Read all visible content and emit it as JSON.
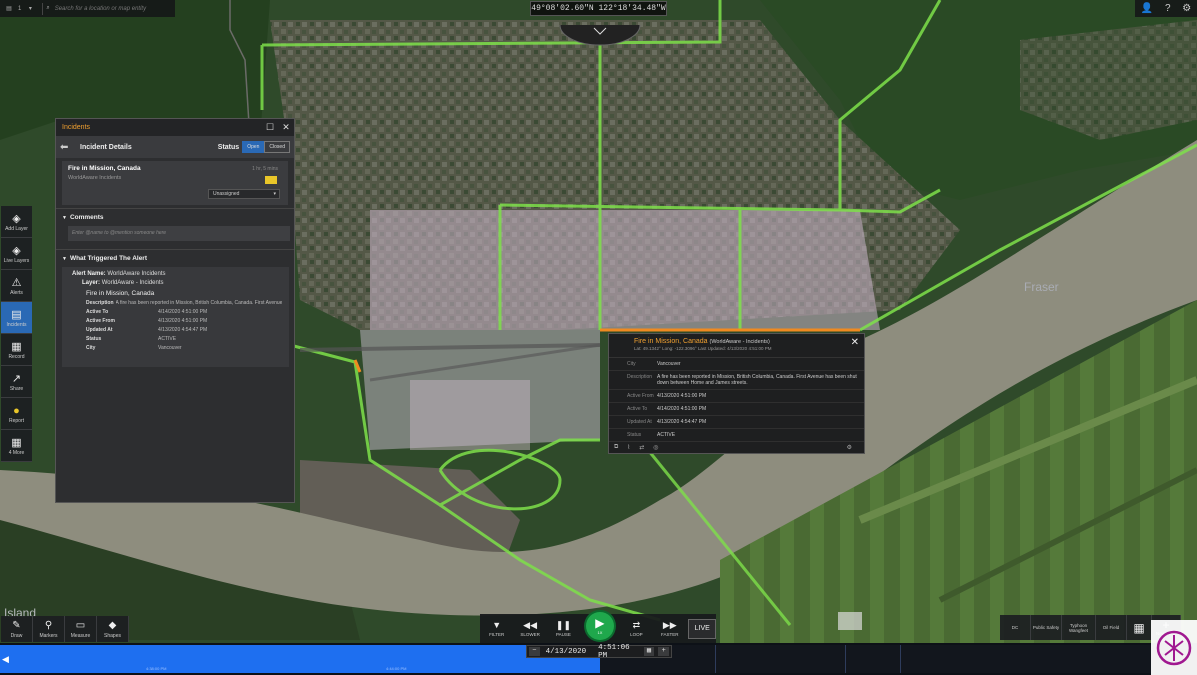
{
  "topbar": {
    "layer_count": "1",
    "search_placeholder": "Search for a location or map entity",
    "coordinates": "49°08'02.60\"N 122°18'34.48\"W"
  },
  "map": {
    "river_label": "Fraser",
    "place_label": "Island"
  },
  "left_toolbar": [
    {
      "label": "Add Layer",
      "icon": "add-layer-icon"
    },
    {
      "label": "Live Layers",
      "icon": "live-layers-icon"
    },
    {
      "label": "Alerts",
      "icon": "alert-icon"
    },
    {
      "label": "Incidents",
      "icon": "incidents-icon"
    },
    {
      "label": "Record",
      "icon": "record-icon"
    },
    {
      "label": "Share",
      "icon": "share-icon"
    },
    {
      "label": "Report",
      "icon": "report-icon"
    },
    {
      "label": "4 More",
      "icon": "more-grid-icon"
    }
  ],
  "incidents": {
    "panel_title": "Incidents",
    "header": "Incident Details",
    "status_label": "Status",
    "status_open": "Open",
    "status_closed": "Closed",
    "name": "Fire in Mission, Canada",
    "source": "WorldAware Incidents",
    "time_ago": "1 hr, 5 mins",
    "assign": "Unassigned",
    "comments_label": "Comments",
    "comment_placeholder": "Enter @name to @mention someone here",
    "triggered_label": "What Triggered The Alert",
    "alert_name_label": "Alert Name:",
    "alert_name": "WorldAware Incidents",
    "layer_label": "Layer:",
    "layer": "WorldAware - Incidents",
    "item_title": "Fire in Mission, Canada",
    "rows": [
      {
        "k": "Description",
        "v": "A fire has been reported in Mission, British Columbia, Canada. First Avenue"
      },
      {
        "k": "Active To",
        "v": "4/14/2020 4:51:00 PM"
      },
      {
        "k": "Active From",
        "v": "4/13/2020 4:51:00 PM"
      },
      {
        "k": "Updated At",
        "v": "4/13/2020 4:54:47 PM"
      },
      {
        "k": "Status",
        "v": "ACTIVE"
      },
      {
        "k": "City",
        "v": "Vancouver"
      }
    ]
  },
  "popup": {
    "title": "Fire in Mission, Canada",
    "source": "(WorldAware - Incidents)",
    "meta": "Lat: 49.1342°  Long: -122.3096°  Last Updated: 4/13/2020 4:51:00 PM",
    "rows": [
      {
        "k": "City",
        "v": "Vancouver"
      },
      {
        "k": "Description",
        "v": "A fire has been reported in Mission, British Columbia, Canada. First Avenue has been shut down between Home and James streets."
      },
      {
        "k": "Active From",
        "v": "4/13/2020 4:51:00 PM"
      },
      {
        "k": "Active To",
        "v": "4/14/2020 4:51:00 PM"
      },
      {
        "k": "Updated At",
        "v": "4/13/2020 4:54:47 PM"
      },
      {
        "k": "Status",
        "v": "ACTIVE"
      }
    ]
  },
  "bottom_tools": [
    {
      "label": "Draw",
      "icon": "pencil-icon"
    },
    {
      "label": "Markers",
      "icon": "pin-icon"
    },
    {
      "label": "Measure",
      "icon": "ruler-icon"
    },
    {
      "label": "Shapes",
      "icon": "shapes-icon"
    }
  ],
  "playback": {
    "filter": "FILTER",
    "slower": "SLOWER",
    "pause": "PAUSE",
    "play_speed": "1X",
    "loop": "LOOP",
    "faster": "FASTER",
    "live": "LIVE"
  },
  "presets": [
    {
      "label": "DC"
    },
    {
      "label": "Public Safety"
    },
    {
      "label": "Typhoon Wangfeet"
    },
    {
      "label": "Oil Field"
    }
  ],
  "new_view": "New View",
  "timeline": {
    "date": "4/13/2020",
    "time": "4:51:06 PM",
    "tick1": "4:38:00 PM",
    "tick2": "4:44:00 PM"
  },
  "colors": {
    "accent_blue": "#2a69b5",
    "incident_orange": "#f0a030",
    "play_green": "#1fa84c",
    "flag_yellow": "#e9c629",
    "road_green": "#7ee04a"
  }
}
